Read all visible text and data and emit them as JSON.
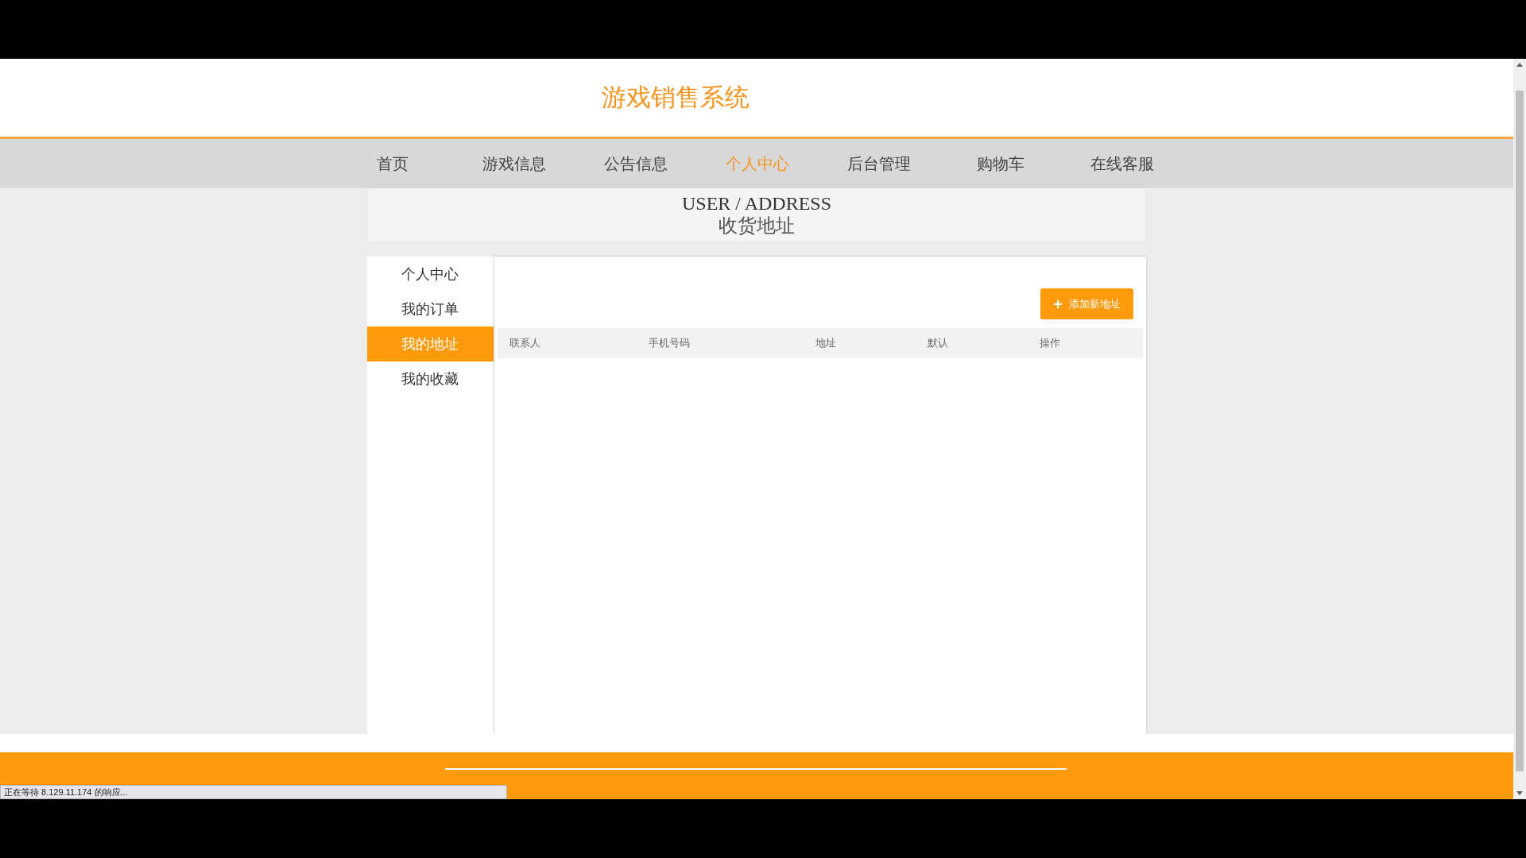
{
  "header": {
    "title": "游戏销售系统"
  },
  "nav": [
    {
      "label": "首页",
      "selected": false
    },
    {
      "label": "游戏信息",
      "selected": false
    },
    {
      "label": "公告信息",
      "selected": false
    },
    {
      "label": "个人中心",
      "selected": true
    },
    {
      "label": "后台管理",
      "selected": false
    },
    {
      "label": "购物车",
      "selected": false
    },
    {
      "label": "在线客服",
      "selected": false
    }
  ],
  "banner": {
    "english": "USER / ADDRESS",
    "chinese": "收货地址"
  },
  "sidebar": {
    "items": [
      {
        "label": "个人中心",
        "selected": false
      },
      {
        "label": "我的订单",
        "selected": false
      },
      {
        "label": "我的地址",
        "selected": true
      },
      {
        "label": "我的收藏",
        "selected": false
      }
    ]
  },
  "add_button": {
    "icon": "+",
    "label": "添加新地址"
  },
  "table": {
    "columns": [
      "联系人",
      "手机号码",
      "地址",
      "默认",
      "操作"
    ]
  },
  "status_bar": {
    "text": "正在等待 8.129.11.174 的响应..."
  }
}
